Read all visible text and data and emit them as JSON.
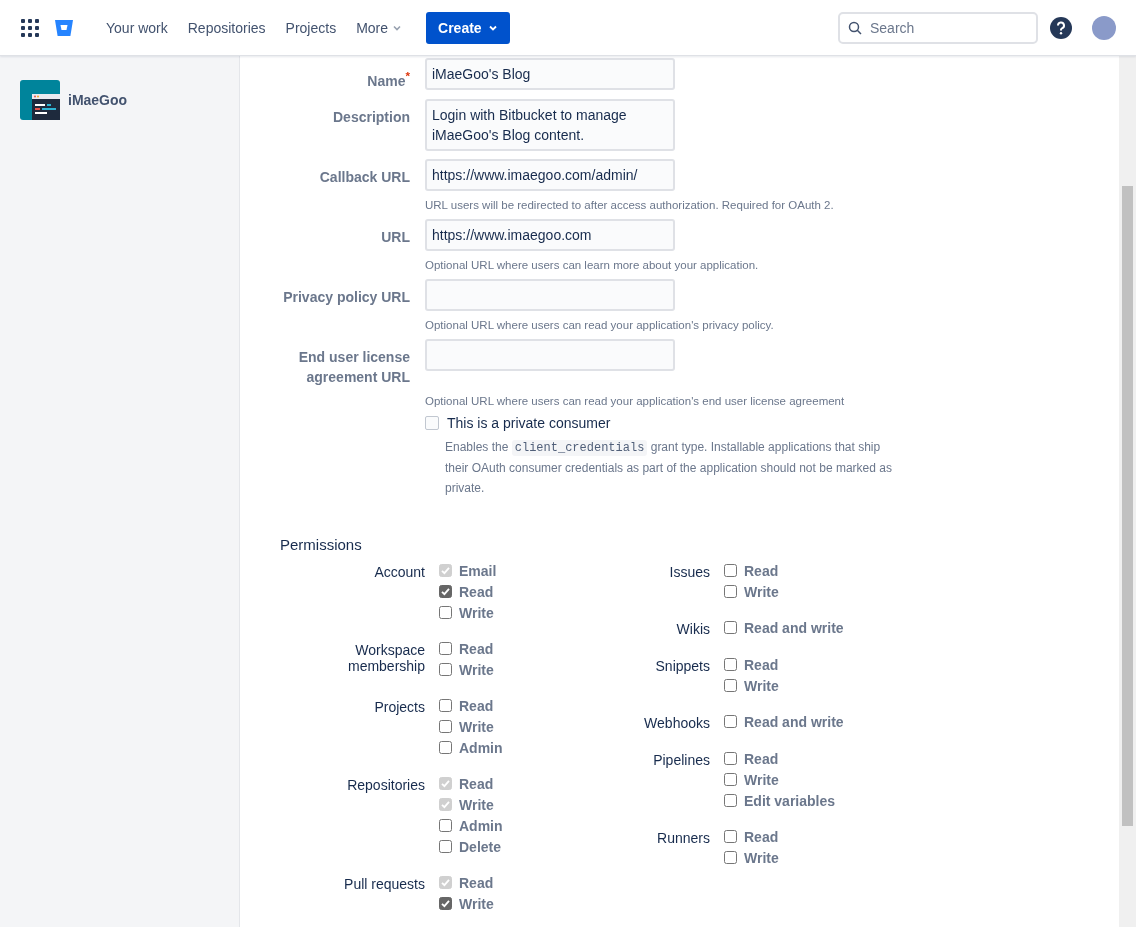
{
  "header": {
    "nav": [
      {
        "label": "Your work",
        "dropdown": false
      },
      {
        "label": "Repositories",
        "dropdown": false
      },
      {
        "label": "Projects",
        "dropdown": false
      },
      {
        "label": "More",
        "dropdown": true
      }
    ],
    "create_button": "Create",
    "search": {
      "placeholder": "Search"
    }
  },
  "sidebar": {
    "workspace": "iMaeGoo"
  },
  "form": {
    "fields": [
      {
        "label": "Name",
        "required_mark": "*",
        "kind": "input",
        "value": "iMaeGoo's Blog"
      },
      {
        "label": "Description",
        "kind": "textarea",
        "value": "Login with Bitbucket to manage iMaeGoo's Blog content."
      },
      {
        "label": "Callback URL",
        "kind": "input",
        "value": "https://www.imaegoo.com/admin/",
        "hint": "URL users will be redirected to after access authorization. Required for OAuth 2."
      },
      {
        "label": "URL",
        "kind": "input",
        "value": "https://www.imaegoo.com",
        "hint": "Optional URL where users can learn more about your application."
      },
      {
        "label": "Privacy policy URL",
        "kind": "input",
        "hint": "Optional URL where users can read your application's privacy policy."
      },
      {
        "label": "End user license agreement URL",
        "kind": "input",
        "hint": "Optional URL where users can read your application's end user license agreement"
      }
    ],
    "private_consumer": {
      "label": "This is a private consumer",
      "checked": false,
      "hint_before": "Enables the",
      "hint_code": "client_credentials",
      "hint_after": "grant type. Installable applications that ship their OAuth consumer credentials as part of the application should not be marked as private."
    }
  },
  "permissions": {
    "title": "Permissions",
    "columns": [
      [
        {
          "label": "Account",
          "options": [
            {
              "label": "Email",
              "checked": true,
              "disabled": true
            },
            {
              "label": "Read",
              "checked": true,
              "disabled": false
            },
            {
              "label": "Write",
              "checked": false,
              "disabled": false
            }
          ]
        },
        {
          "label": "Workspace membership",
          "options": [
            {
              "label": "Read",
              "checked": false,
              "disabled": false
            },
            {
              "label": "Write",
              "checked": false,
              "disabled": false
            }
          ]
        },
        {
          "label": "Projects",
          "options": [
            {
              "label": "Read",
              "checked": false,
              "disabled": false
            },
            {
              "label": "Write",
              "checked": false,
              "disabled": false
            },
            {
              "label": "Admin",
              "checked": false,
              "disabled": false
            }
          ]
        },
        {
          "label": "Repositories",
          "options": [
            {
              "label": "Read",
              "checked": true,
              "disabled": true
            },
            {
              "label": "Write",
              "checked": true,
              "disabled": true
            },
            {
              "label": "Admin",
              "checked": false,
              "disabled": false
            },
            {
              "label": "Delete",
              "checked": false,
              "disabled": false
            }
          ]
        },
        {
          "label": "Pull requests",
          "options": [
            {
              "label": "Read",
              "checked": true,
              "disabled": true
            },
            {
              "label": "Write",
              "checked": true,
              "disabled": false
            }
          ]
        }
      ],
      [
        {
          "label": "Issues",
          "options": [
            {
              "label": "Read",
              "checked": false,
              "disabled": false
            },
            {
              "label": "Write",
              "checked": false,
              "disabled": false
            }
          ]
        },
        {
          "label": "Wikis",
          "options": [
            {
              "label": "Read and write",
              "checked": false,
              "disabled": false
            }
          ]
        },
        {
          "label": "Snippets",
          "options": [
            {
              "label": "Read",
              "checked": false,
              "disabled": false
            },
            {
              "label": "Write",
              "checked": false,
              "disabled": false
            }
          ]
        },
        {
          "label": "Webhooks",
          "options": [
            {
              "label": "Read and write",
              "checked": false,
              "disabled": false
            }
          ]
        },
        {
          "label": "Pipelines",
          "options": [
            {
              "label": "Read",
              "checked": false,
              "disabled": false
            },
            {
              "label": "Write",
              "checked": false,
              "disabled": false
            },
            {
              "label": "Edit variables",
              "checked": false,
              "disabled": false
            }
          ]
        },
        {
          "label": "Runners",
          "options": [
            {
              "label": "Read",
              "checked": false,
              "disabled": false
            },
            {
              "label": "Write",
              "checked": false,
              "disabled": false
            }
          ]
        }
      ]
    ]
  }
}
